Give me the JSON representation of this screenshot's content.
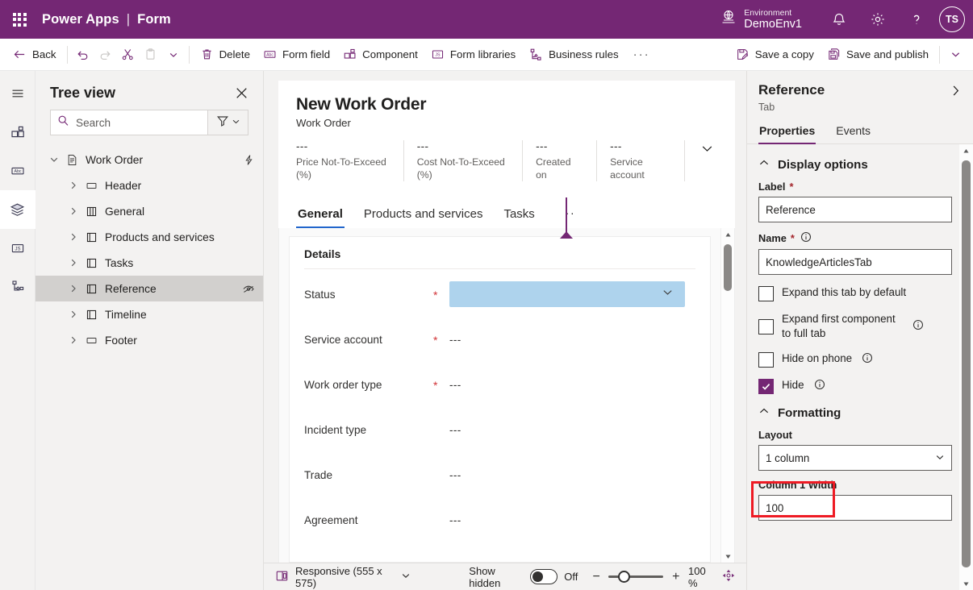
{
  "topbar": {
    "waffle_icon": "app-launcher-icon",
    "brand": "Power Apps",
    "separator": "|",
    "page": "Form",
    "environment_label": "Environment",
    "environment_name": "DemoEnv1",
    "globe_icon": "environment-globe-icon",
    "bell_icon": "notifications-bell-icon",
    "gear_icon": "settings-gear-icon",
    "help_icon": "help-question-icon",
    "avatar_initials": "TS",
    "brand_color": "#742774"
  },
  "commandbar": {
    "back": "Back",
    "undo_icon": "undo-icon",
    "redo_icon": "redo-icon",
    "cut_icon": "cut-scissors-icon",
    "paste_icon": "paste-clipboard-icon",
    "paste_chevron_icon": "chevron-down-icon",
    "delete": "Delete",
    "form_field": "Form field",
    "component": "Component",
    "form_libraries": "Form libraries",
    "business_rules": "Business rules",
    "overflow": "···",
    "save_a_copy": "Save a copy",
    "save_and_publish": "Save and publish",
    "save_chevron_icon": "chevron-down-icon"
  },
  "rail": {
    "items": [
      {
        "icon": "hamburger-menu-icon",
        "active": false
      },
      {
        "icon": "components-icon",
        "active": false
      },
      {
        "icon": "table-columns-abc-icon",
        "active": false
      },
      {
        "icon": "layers-tree-icon",
        "active": true
      },
      {
        "icon": "javascript-js-icon",
        "active": false
      },
      {
        "icon": "business-rules-icon",
        "active": false
      }
    ]
  },
  "treeview": {
    "title": "Tree view",
    "close_icon": "close-icon",
    "search_placeholder": "Search",
    "search_value": "",
    "search_icon": "search-icon",
    "filter_icon": "filter-funnel-icon",
    "filter_chevron_icon": "chevron-down-icon",
    "items": [
      {
        "label": "Work Order",
        "icon": "form-page-icon",
        "caret": "chevron-down-icon",
        "depth": 0,
        "selected": false,
        "trail_icon": "lightning-event-icon"
      },
      {
        "label": "Header",
        "icon": "header-rectangle-icon",
        "caret": "chevron-right-icon",
        "depth": 1,
        "selected": false,
        "trail_icon": ""
      },
      {
        "label": "General",
        "icon": "tab-columns-icon",
        "caret": "chevron-right-icon",
        "depth": 1,
        "selected": false,
        "trail_icon": ""
      },
      {
        "label": "Products and services",
        "icon": "tab-folder-icon",
        "caret": "chevron-right-icon",
        "depth": 1,
        "selected": false,
        "trail_icon": ""
      },
      {
        "label": "Tasks",
        "icon": "tab-folder-icon",
        "caret": "chevron-right-icon",
        "depth": 1,
        "selected": false,
        "trail_icon": ""
      },
      {
        "label": "Reference",
        "icon": "tab-folder-icon",
        "caret": "chevron-right-icon",
        "depth": 1,
        "selected": true,
        "trail_icon": "hidden-eye-slash-icon"
      },
      {
        "label": "Timeline",
        "icon": "tab-folder-icon",
        "caret": "chevron-right-icon",
        "depth": 1,
        "selected": false,
        "trail_icon": ""
      },
      {
        "label": "Footer",
        "icon": "header-rectangle-icon",
        "caret": "chevron-right-icon",
        "depth": 1,
        "selected": false,
        "trail_icon": ""
      }
    ]
  },
  "canvas": {
    "form_title": "New Work Order",
    "form_subtitle": "Work Order",
    "header_fields": [
      {
        "value": "---",
        "label": "Price Not-To-Exceed (%)"
      },
      {
        "value": "---",
        "label": "Cost Not-To-Exceed (%)"
      },
      {
        "value": "---",
        "label": "Created on"
      },
      {
        "value": "---",
        "label": "Service account"
      }
    ],
    "header_expand_icon": "chevron-down-icon",
    "tabs": [
      {
        "label": "General",
        "active": true
      },
      {
        "label": "Products and services",
        "active": false
      },
      {
        "label": "Tasks",
        "active": false
      }
    ],
    "tab_overflow": "··",
    "drop_marker_color": "#742774",
    "section_title": "Details",
    "fields": [
      {
        "label": "Status",
        "required": true,
        "value": "",
        "control": "dropdown",
        "highlight_color": "#aed3ed"
      },
      {
        "label": "Service account",
        "required": true,
        "value": "---",
        "control": "text"
      },
      {
        "label": "Work order type",
        "required": true,
        "value": "---",
        "control": "text"
      },
      {
        "label": "Incident type",
        "required": false,
        "value": "---",
        "control": "text"
      },
      {
        "label": "Trade",
        "required": false,
        "value": "---",
        "control": "text"
      },
      {
        "label": "Agreement",
        "required": false,
        "value": "---",
        "control": "text"
      }
    ],
    "scroll_up_icon": "scroll-up-arrow-icon",
    "scroll_down_icon": "scroll-down-arrow-icon"
  },
  "statusbar": {
    "layout_icon": "responsive-layout-icon",
    "layout_label": "Responsive (555 x 575)",
    "layout_chevron_icon": "chevron-down-icon",
    "show_hidden_label": "Show hidden",
    "show_hidden_state": "Off",
    "zoom_out": "−",
    "zoom_in": "+",
    "zoom_level": "100 %",
    "fit_icon": "fit-to-screen-icon"
  },
  "properties": {
    "title": "Reference",
    "expand_icon": "chevron-right-icon",
    "subtitle": "Tab",
    "tabs": [
      {
        "label": "Properties",
        "active": true
      },
      {
        "label": "Events",
        "active": false
      }
    ],
    "display_options": {
      "group_title": "Display options",
      "collapse_icon": "chevron-up-icon",
      "label_field_label": "Label",
      "label_required": "*",
      "label_value": "Reference",
      "name_field_label": "Name",
      "name_required": "*",
      "name_info_icon": "info-circle-icon",
      "name_value": "KnowledgeArticlesTab",
      "checkboxes": [
        {
          "label": "Expand this tab by default",
          "checked": false,
          "info": false
        },
        {
          "label": "Expand first component to full tab",
          "checked": false,
          "info": true
        },
        {
          "label": "Hide on phone",
          "checked": false,
          "info": true
        },
        {
          "label": "Hide",
          "checked": true,
          "info": true,
          "highlighted": true
        }
      ]
    },
    "formatting": {
      "group_title": "Formatting",
      "collapse_icon": "chevron-up-icon",
      "layout_label": "Layout",
      "layout_value": "1 column",
      "layout_chevron_icon": "chevron-down-icon",
      "column1_label": "Column 1 Width",
      "column1_value": "100"
    },
    "highlight_color": "#ee1b24",
    "scroll_up_icon": "scroll-up-arrow-icon",
    "scroll_down_icon": "scroll-down-arrow-icon"
  }
}
